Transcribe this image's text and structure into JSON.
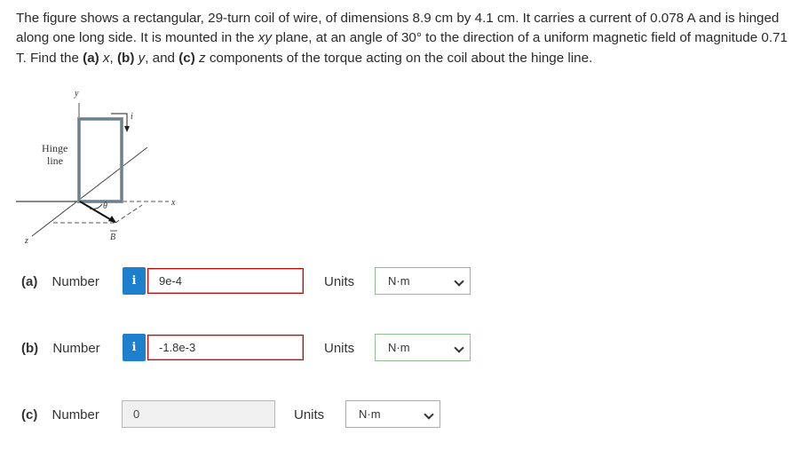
{
  "problem": {
    "t1": "The figure shows a rectangular, 29-turn coil of wire, of dimensions 8.9 cm by 4.1 cm. It carries a current of 0.078 A and is hinged along one long side. It is mounted in the ",
    "xy": "xy",
    "t2": " plane, at an angle of 30° to the direction of a uniform magnetic field of magnitude 0.71 T. Find the ",
    "pa": "(a)",
    "xa": " x",
    "t3": ", ",
    "pb": "(b)",
    "yb": " y",
    "t4": ", and ",
    "pc": "(c)",
    "zc": " z",
    "t5": " components of the torque acting on the coil about the hinge line."
  },
  "figure": {
    "y_label": "y",
    "x_label": "x",
    "z_label": "z",
    "i_label": "i",
    "theta_label": "θ",
    "b_label": "B",
    "hinge_line1": "Hinge",
    "hinge_line2": "line"
  },
  "parts": [
    {
      "letter": "(a)",
      "label": "Number",
      "info": "i",
      "value": "9e-4",
      "state": "invalid",
      "units_label": "Units",
      "units": "N·m"
    },
    {
      "letter": "(b)",
      "label": "Number",
      "info": "i",
      "value": "-1.8e-3",
      "state": "invalid",
      "units_label": "Units",
      "units": "N·m"
    },
    {
      "letter": "(c)",
      "label": "Number",
      "value": "0",
      "state": "disabled",
      "units_label": "Units",
      "units": "N·m"
    }
  ]
}
